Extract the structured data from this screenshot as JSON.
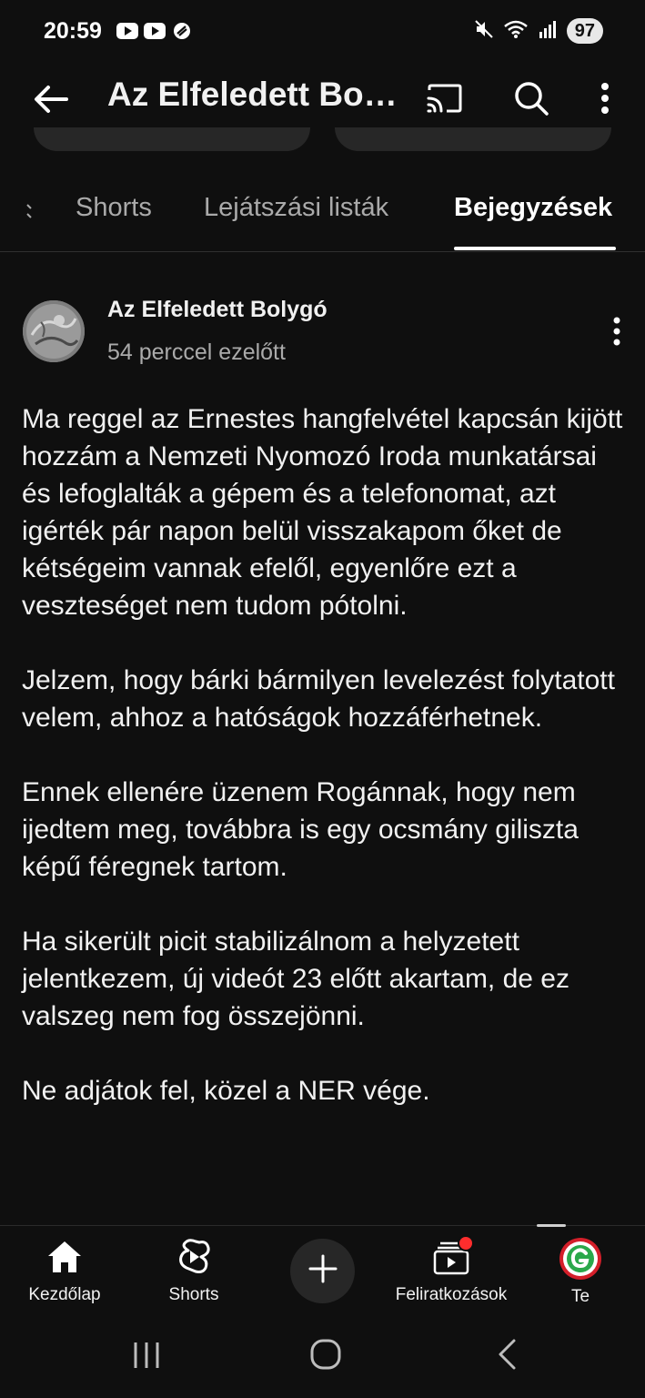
{
  "status_bar": {
    "time": "20:59",
    "battery": "97",
    "left_icons": [
      "youtube-icon",
      "youtube-icon",
      "vpn-icon"
    ],
    "right_icons": [
      "mute-icon",
      "wifi-icon",
      "signal-icon"
    ]
  },
  "app_bar": {
    "title": "Az Elfeledett Bo…",
    "icons": [
      "back-arrow-icon",
      "cast-icon",
      "search-icon",
      "more-vert-icon"
    ]
  },
  "tabs": {
    "items": [
      {
        "label": "Shorts",
        "active": false
      },
      {
        "label": "Lejátszási listák",
        "active": false
      },
      {
        "label": "Bejegyzések",
        "active": true
      }
    ]
  },
  "post": {
    "author": "Az Elfeledett Bolygó",
    "time": "54 perccel ezelőtt",
    "paragraphs": [
      "Ma reggel az Ernestes hangfelvétel kapcsán kijött hozzám a Nemzeti Nyomozó Iroda munkatársai és lefoglalták a gépem és a telefonomat, azt igérték pár napon belül visszakapom őket de kétségeim vannak efelől, egyenlőre ezt a veszteséget nem tudom pótolni.",
      "Jelzem, hogy bárki bármilyen levelezést folytatott velem, ahhoz a hatóságok hozzáférhetnek.",
      "Ennek ellenére üzenem Rogánnak, hogy nem ijedtem meg, továbbra is egy ocsmány giliszta képű féregnek tartom.",
      "Ha sikerült picit stabilizálnom a helyzetett jelentkezem, új videót 23 előtt akartam, de ez valszeg nem fog összejönni.",
      "Ne adjátok fel, közel a NER vége."
    ]
  },
  "bottom_nav": {
    "items": [
      {
        "label": "Kezdőlap",
        "icon": "home-icon"
      },
      {
        "label": "Shorts",
        "icon": "shorts-icon"
      },
      {
        "label": "",
        "icon": "plus-icon"
      },
      {
        "label": "Feliratkozások",
        "icon": "subscriptions-icon"
      },
      {
        "label": "Te",
        "icon": "profile-avatar-icon"
      }
    ],
    "notification_color": "#ff2d2d"
  },
  "system_nav": {
    "icons": [
      "recent-apps-icon",
      "home-circle-icon",
      "back-chevron-icon"
    ]
  },
  "colors": {
    "background": "#0f0f0f",
    "text": "#f1f1f1",
    "secondary_text": "#aaaaaa"
  }
}
